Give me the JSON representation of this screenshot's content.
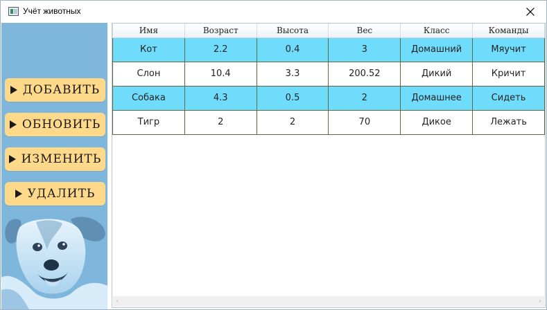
{
  "window": {
    "title": "Учёт животных",
    "icons": {
      "app": "app-window-icon",
      "close": "close-icon"
    }
  },
  "sidebar": {
    "buttons": [
      {
        "label": "ДОБАВИТЬ",
        "icon": "play-triangle-icon"
      },
      {
        "label": "ОБНОВИТЬ",
        "icon": "play-triangle-icon"
      },
      {
        "label": "ИЗМЕНИТЬ",
        "icon": "play-triangle-icon"
      },
      {
        "label": "УДАЛИТЬ",
        "icon": "play-triangle-icon"
      }
    ],
    "image": "dog-photo"
  },
  "table": {
    "columns": [
      "Имя",
      "Возраст",
      "Высота",
      "Вес",
      "Класс",
      "Команды"
    ],
    "rows": [
      [
        "Кот",
        "2.2",
        "0.4",
        "3",
        "Домашний",
        "Мяучит"
      ],
      [
        "Слон",
        "10.4",
        "3.3",
        "200.52",
        "Дикий",
        "Кричит"
      ],
      [
        "Собака",
        "4.3",
        "0.5",
        "2",
        "Домашнее",
        "Сидеть"
      ],
      [
        "Тигр",
        "2",
        "2",
        "70",
        "Дикое",
        "Лежать"
      ]
    ]
  },
  "colors": {
    "sidebar_bg": "#7fb6dc",
    "button_bg": "#ffd98a",
    "row_highlight": "#6fdcfb"
  },
  "scrollbar": {
    "left_arrow": "‹",
    "right_arrow": "›"
  }
}
